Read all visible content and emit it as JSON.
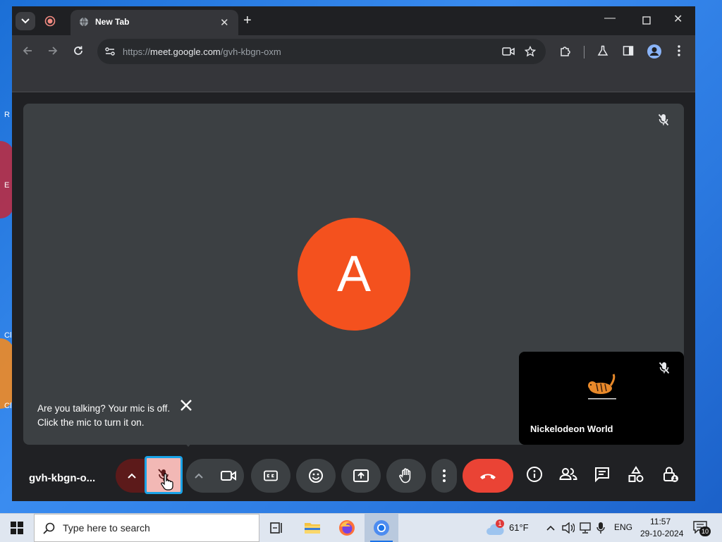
{
  "desktop": {
    "icon_letters": [
      "R",
      "E",
      "Cl",
      "Cl"
    ]
  },
  "browser": {
    "tab_title": "New Tab",
    "url_prefix": "https://",
    "url_host": "meet.google.com",
    "url_path": "/gvh-kbgn-oxm"
  },
  "meet": {
    "avatar_letter": "A",
    "tooltip_text": "Are you talking? Your mic is off. Click the mic to turn it on.",
    "tile_name": "Nickelodeon World",
    "meeting_code": "gvh-kbgn-o...",
    "end_call_color": "#ea4335",
    "avatar_color": "#f4511e"
  },
  "taskbar": {
    "search_placeholder": "Type here to search",
    "temperature": "61°F",
    "weather_badge": "1",
    "language": "ENG",
    "time": "11:57",
    "date": "29-10-2024",
    "notification_count": "10"
  }
}
